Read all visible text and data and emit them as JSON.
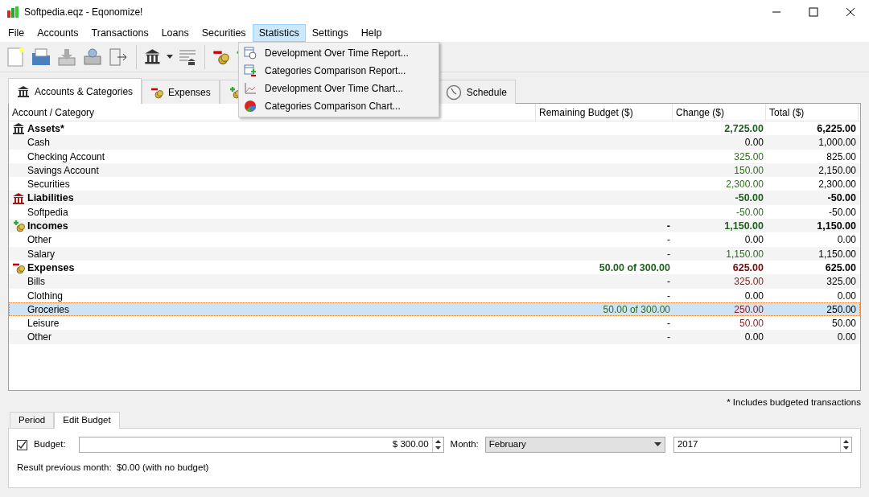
{
  "window": {
    "title": "Softpedia.eqz - Eqonomize!"
  },
  "menu": [
    {
      "label": "File",
      "selected": false
    },
    {
      "label": "Accounts",
      "selected": false
    },
    {
      "label": "Transactions",
      "selected": false
    },
    {
      "label": "Loans",
      "selected": false
    },
    {
      "label": "Securities",
      "selected": false
    },
    {
      "label": "Statistics",
      "selected": true
    },
    {
      "label": "Settings",
      "selected": false
    },
    {
      "label": "Help",
      "selected": false
    }
  ],
  "dropdown": [
    {
      "kind": "report-time",
      "label": "Development Over Time Report..."
    },
    {
      "kind": "report-compare",
      "label": "Categories Comparison Report..."
    },
    {
      "kind": "chart-line",
      "label": "Development Over Time Chart..."
    },
    {
      "kind": "chart-pie",
      "label": "Categories Comparison Chart..."
    }
  ],
  "tabs": [
    {
      "kind": "bank",
      "label": "Accounts & Categories",
      "selected": true
    },
    {
      "kind": "expense",
      "label": "Expenses",
      "selected": false
    },
    {
      "kind": "income",
      "selected": false
    },
    {
      "kind": "clock",
      "label": "Schedule",
      "selected": false
    }
  ],
  "table": {
    "columns": [
      "Account / Category",
      "Remaining Budget ($)",
      "Change ($)",
      "Total ($)"
    ],
    "rows": [
      {
        "kind": "assets",
        "name": "Assets*",
        "selected": false,
        "change": {
          "text": "2,725.00",
          "color": "#1e5e1e"
        },
        "total": "6,225.00"
      },
      {
        "kind": "item",
        "name": "Cash",
        "selected": false,
        "change": {
          "text": "0.00"
        },
        "total": "1,000.00"
      },
      {
        "kind": "item",
        "name": "Checking Account",
        "selected": false,
        "change": {
          "text": "325.00",
          "color": "#2e6b1e"
        },
        "total": "825.00"
      },
      {
        "kind": "item",
        "name": "Savings Account",
        "selected": false,
        "change": {
          "text": "150.00",
          "color": "#2e6b1e"
        },
        "total": "2,150.00"
      },
      {
        "kind": "item",
        "name": "Securities",
        "selected": false,
        "change": {
          "text": "2,300.00",
          "color": "#2e6b1e"
        },
        "total": "2,300.00"
      },
      {
        "kind": "liabilities",
        "name": "Liabilities",
        "selected": false,
        "change": {
          "text": "-50.00",
          "color": "#1e5e1e"
        },
        "total": "-50.00"
      },
      {
        "kind": "item",
        "name": "Softpedia",
        "selected": false,
        "change": {
          "text": "-50.00",
          "color": "#2e6b1e"
        },
        "total": "-50.00"
      },
      {
        "kind": "incomes",
        "name": "Incomes",
        "selected": false,
        "remaining": {
          "text": "-"
        },
        "change": {
          "text": "1,150.00",
          "color": "#1e5e1e"
        },
        "total": "1,150.00"
      },
      {
        "kind": "item",
        "name": "Other",
        "selected": false,
        "remaining": {
          "text": "-"
        },
        "change": {
          "text": "0.00"
        },
        "total": "0.00"
      },
      {
        "kind": "item",
        "name": "Salary",
        "selected": false,
        "remaining": {
          "text": "-"
        },
        "change": {
          "text": "1,150.00",
          "color": "#2e6b1e"
        },
        "total": "1,150.00"
      },
      {
        "kind": "expenses",
        "name": "Expenses",
        "selected": false,
        "remaining": {
          "text": "50.00 of 300.00",
          "color": "#1e5e1e"
        },
        "change": {
          "text": "625.00",
          "color": "#6b0f0f"
        },
        "total": "625.00"
      },
      {
        "kind": "item",
        "name": "Bills",
        "selected": false,
        "remaining": {
          "text": "-"
        },
        "change": {
          "text": "325.00",
          "color": "#8b1a1a"
        },
        "total": "325.00"
      },
      {
        "kind": "item",
        "name": "Clothing",
        "selected": false,
        "remaining": {
          "text": "-"
        },
        "change": {
          "text": "0.00"
        },
        "total": "0.00"
      },
      {
        "kind": "item",
        "name": "Groceries",
        "selected": true,
        "remaining": {
          "text": "50.00 of 300.00",
          "color": "#2e6b1e"
        },
        "change": {
          "text": "250.00",
          "color": "#8b1a1a"
        },
        "total": "250.00"
      },
      {
        "kind": "item",
        "name": "Leisure",
        "selected": false,
        "remaining": {
          "text": "-"
        },
        "change": {
          "text": "50.00",
          "color": "#8b1a1a"
        },
        "total": "50.00"
      },
      {
        "kind": "item",
        "name": "Other",
        "selected": false,
        "remaining": {
          "text": "-"
        },
        "change": {
          "text": "0.00"
        },
        "total": "0.00"
      }
    ]
  },
  "note": "* Includes budgeted transactions",
  "bottom_tabs": [
    {
      "label": "Period",
      "selected": false
    },
    {
      "label": "Edit Budget",
      "selected": true
    }
  ],
  "budget": {
    "checked": true,
    "label": "Budget:",
    "value": "$ 300.00",
    "month_label": "Month:",
    "month": "February",
    "year": "2017"
  },
  "result": "Result previous month:  $0.00 (with no budget)"
}
